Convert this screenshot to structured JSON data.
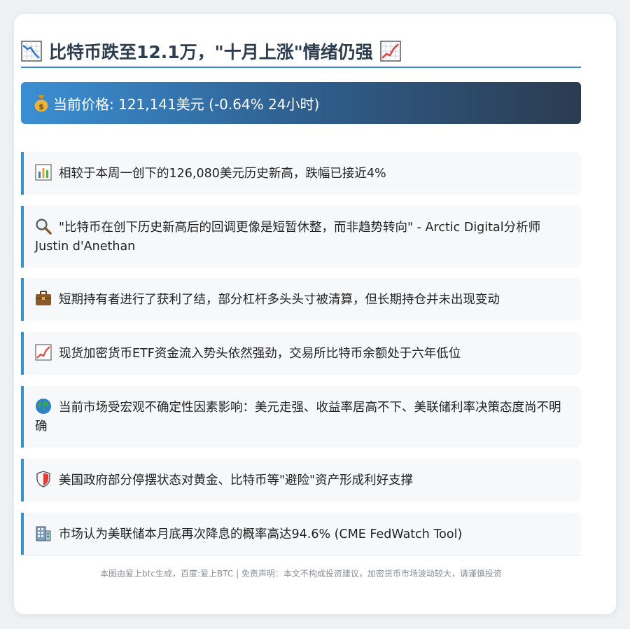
{
  "header": {
    "title": "比特币跌至12.1万，\"十月上涨\"情绪仍强",
    "left_icon": "chart-decreasing-icon",
    "right_icon": "chart-increasing-icon"
  },
  "price_bar": {
    "icon": "money-bag-icon",
    "text": "当前价格: 121,141美元 (-0.64% 24小时)"
  },
  "items": [
    {
      "icon": "bar-chart-icon",
      "text": "相较于本周一创下的126,080美元历史新高，跌幅已接近4%"
    },
    {
      "icon": "magnifier-icon",
      "text": "\"比特币在创下历史新高后的回调更像是短暂休整，而非趋势转向\" - Arctic Digital分析师Justin d'Anethan"
    },
    {
      "icon": "briefcase-icon",
      "text": "短期持有者进行了获利了结，部分杠杆多头头寸被清算，但长期持仓并未出现变动"
    },
    {
      "icon": "chart-increasing-icon",
      "text": "现货加密货币ETF资金流入势头依然强劲，交易所比特币余额处于六年低位"
    },
    {
      "icon": "globe-icon",
      "text": "当前市场受宏观不确定性因素影响：美元走强、收益率居高不下、美联储利率决策态度尚不明确"
    },
    {
      "icon": "shield-icon",
      "text": "美国政府部分停摆状态对黄金、比特币等\"避险\"资产形成利好支撑"
    },
    {
      "icon": "bank-building-icon",
      "text": "市场认为美联储本月底再次降息的概率高达94.6% (CME FedWatch Tool)"
    }
  ],
  "footer": {
    "text": "本图由爱上btc生成，百度:爱上BTC | 免责声明：本文不构成投资建议，加密货币市场波动较大，请谨慎投资"
  },
  "colors": {
    "accent": "#3a8fd0",
    "title": "#2c3e50",
    "item_bg": "#f6f8fa",
    "gradient_start": "#3b8fd4",
    "gradient_end": "#2b3b50"
  }
}
